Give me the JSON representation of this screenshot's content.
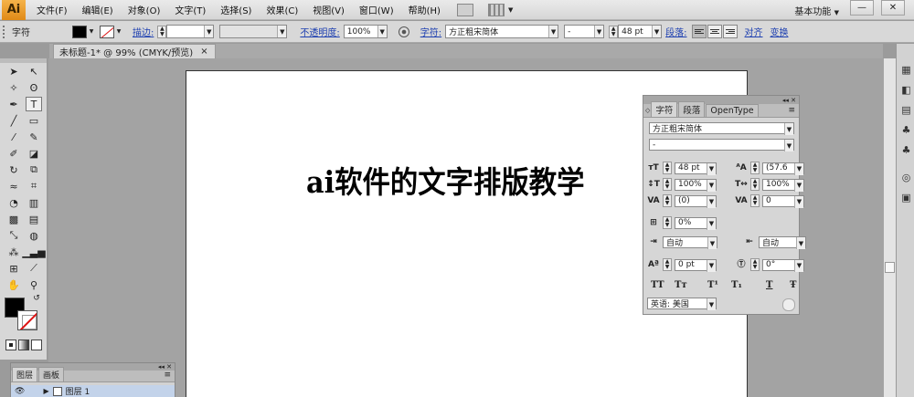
{
  "app": {
    "logo": "Ai",
    "menu": [
      "文件(F)",
      "编辑(E)",
      "对象(O)",
      "文字(T)",
      "选择(S)",
      "效果(C)",
      "视图(V)",
      "窗口(W)",
      "帮助(H)"
    ],
    "workspace": "基本功能",
    "workspace_arrow": "▼",
    "win_min": "—",
    "win_close": "✕"
  },
  "control_bar": {
    "mode_label": "字符",
    "stroke_label": "描边:",
    "opacity_label": "不透明度:",
    "opacity_value": "100%",
    "char_label": "字符:",
    "font_family": "方正粗宋简体",
    "font_style": "-",
    "font_size": "48 pt",
    "paragraph_label": "段落:",
    "align_label": "对齐",
    "transform_label": "变换"
  },
  "document": {
    "tab_title": "未标题-1* @ 99% (CMYK/预览)",
    "tab_close": "×",
    "artwork_text": "ai软件的文字排版教学"
  },
  "char_panel": {
    "tabs": [
      "字符",
      "段落",
      "OpenType"
    ],
    "collapse": "◂◂ ✕",
    "menu_icon": "≡",
    "font_family": "方正粗宋简体",
    "font_style": "-",
    "font_size": "48 pt",
    "leading": "(57.6",
    "vertical_scale": "100%",
    "horizontal_scale": "100%",
    "kerning": "(0)",
    "tracking": "0",
    "tsume": "0%",
    "aki_left": "自动",
    "aki_right": "自动",
    "baseline_shift": "0 pt",
    "rotation": "0°",
    "style_buttons": [
      "TT",
      "Tт",
      "T¹",
      "T₁",
      "T",
      "Ŧ"
    ],
    "language": "英语: 美国"
  },
  "layers_panel": {
    "tabs": [
      "图层",
      "画板"
    ],
    "collapse": "◂◂ ✕",
    "layer_name": "图层 1"
  }
}
